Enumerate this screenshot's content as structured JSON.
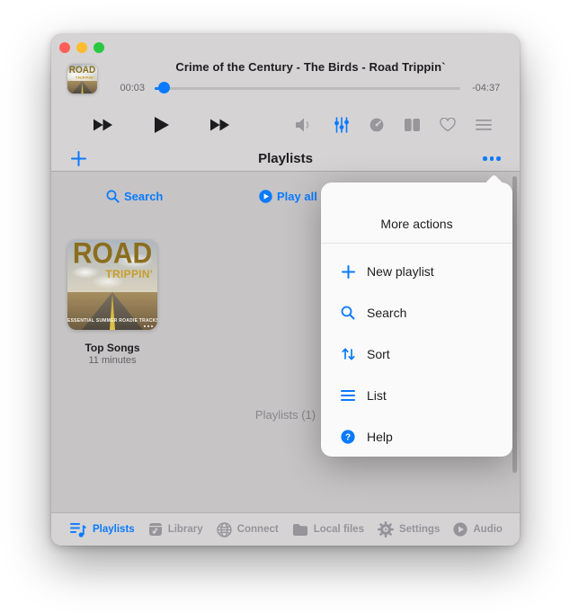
{
  "player": {
    "song_title": "Crime of the Century - The Birds - Road Trippin`",
    "elapsed": "00:03",
    "remaining": "-04:37",
    "progress_pct": 3
  },
  "header": {
    "title": "Playlists"
  },
  "toolbar": {
    "search_label": "Search",
    "play_all_label": "Play all"
  },
  "playlist_card": {
    "art_title": "ROAD",
    "art_subtitle": "TRIPPIN'",
    "art_caption": "ESSENTIAL SUMMER ROADIE TRACKS",
    "name": "Top Songs",
    "duration": "11 minutes"
  },
  "status_text": "Playlists (1)",
  "popover": {
    "title": "More actions",
    "items": [
      {
        "icon": "plus-icon",
        "label": "New playlist"
      },
      {
        "icon": "search-icon",
        "label": "Search"
      },
      {
        "icon": "sort-icon",
        "label": "Sort"
      },
      {
        "icon": "list-icon",
        "label": "List"
      },
      {
        "icon": "help-icon",
        "label": "Help"
      }
    ]
  },
  "tabbar": {
    "items": [
      {
        "icon": "playlists-icon",
        "label": "Playlists",
        "active": true
      },
      {
        "icon": "library-icon",
        "label": "Library",
        "active": false
      },
      {
        "icon": "connect-icon",
        "label": "Connect",
        "active": false
      },
      {
        "icon": "local-files-icon",
        "label": "Local files",
        "active": false
      },
      {
        "icon": "settings-icon",
        "label": "Settings",
        "active": false
      },
      {
        "icon": "audio-icon",
        "label": "Audio",
        "active": false
      }
    ]
  },
  "colors": {
    "accent": "#0a7aff",
    "traffic_red": "#ff5f57",
    "traffic_yellow": "#febc2e",
    "traffic_green": "#28c840",
    "window_bg": "#d5d3d4",
    "content_bg": "#c6c4c5",
    "popover_bg": "#fbfafa"
  }
}
